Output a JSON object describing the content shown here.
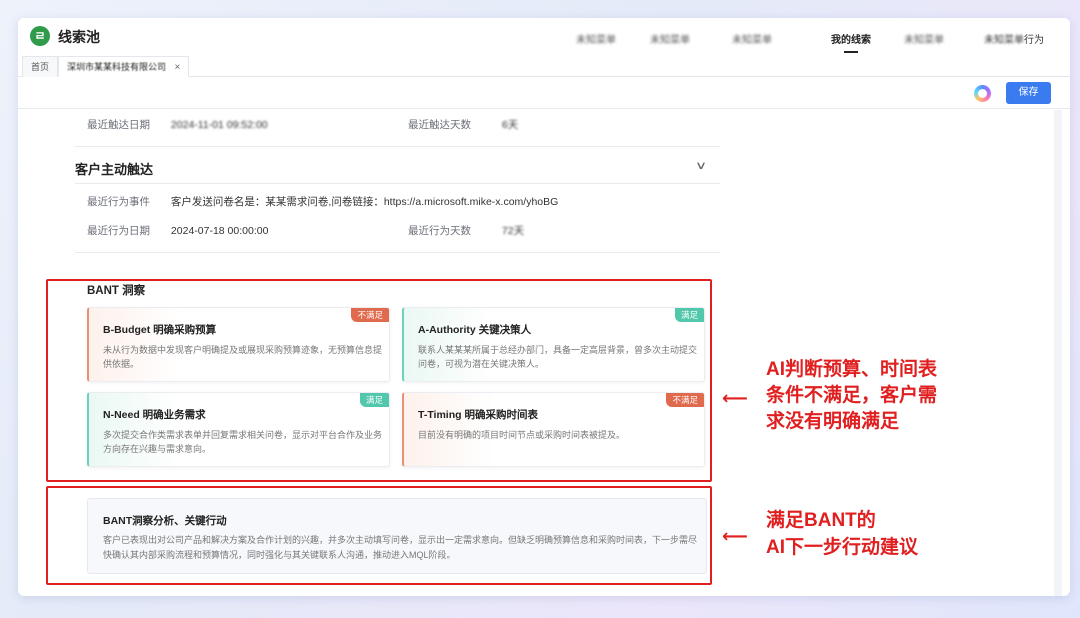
{
  "app": {
    "title": "线索池",
    "logo_glyph": "ㄹ"
  },
  "nav": {
    "items": [
      "未知菜单",
      "未知菜单",
      "未知菜单",
      "我的线索",
      "未知菜单"
    ],
    "last_item_suffix": "行为",
    "active": "我的线索"
  },
  "tabs": {
    "home": "首页",
    "current": "深圳市某某科技有限公司",
    "close": "×"
  },
  "toolbar": {
    "save_label": "保存",
    "ai_icon": "ai-assistant-icon"
  },
  "touch_top": {
    "last_date_label": "最近触达日期",
    "last_date_value": "2024-11-01 09:52:00",
    "last_days_label": "最近触达天数",
    "last_days_value": "6天"
  },
  "customer_touch": {
    "title": "客户主动触达",
    "event_label": "最近行为事件",
    "event_value": "客户发送问卷名是：某某需求问卷,问卷链接：https://a.microsoft.mike-x.com/yhoBG",
    "date_label": "最近行为日期",
    "date_value": "2024-07-18 00:00:00",
    "days_label": "最近行为天数",
    "days_value": "72天"
  },
  "bant": {
    "title": "BANT 洞察",
    "cards": [
      {
        "title": "B-Budget 明确采购预算",
        "badge": "不满足",
        "status": "unmet",
        "desc": "未从行为数据中发现客户明确提及或展现采购预算迹象，无预算信息提供依据。"
      },
      {
        "title": "A-Authority 关键决策人",
        "badge": "满足",
        "status": "met",
        "desc": "联系人某某某所属于总经办部门，具备一定高层背景，曾多次主动提交问卷，可视为潜在关键决策人。"
      },
      {
        "title": "N-Need 明确业务需求",
        "badge": "满足",
        "status": "met",
        "desc": "多次提交合作类需求表单并回复需求相关问卷，显示对平台合作及业务方向存在兴趣与需求意向。"
      },
      {
        "title": "T-Timing 明确采购时间表",
        "badge": "不满足",
        "status": "unmet",
        "desc": "目前没有明确的项目时间节点或采购时间表被提及。"
      }
    ]
  },
  "analysis": {
    "title": "BANT洞察分析、关键行动",
    "text": "客户已表现出对公司产品和解决方案及合作计划的兴趣，并多次主动填写问卷，显示出一定需求意向。但缺乏明确预算信息和采购时间表，下一步需尽快确认其内部采购流程和预算情况，同时强化与其关键联系人沟通，推动进入MQL阶段。"
  },
  "annotations": {
    "first": [
      "AI判断预算、时间表",
      "条件不满足，客户需",
      "求没有明确满足"
    ],
    "second": [
      "满足BANT的",
      "AI下一步行动建议"
    ],
    "arrow": "⟵"
  },
  "colors": {
    "accent": "#3a7cf0",
    "unmet": "#e06a4e",
    "met": "#52c7ab",
    "highlight": "#e02020"
  }
}
